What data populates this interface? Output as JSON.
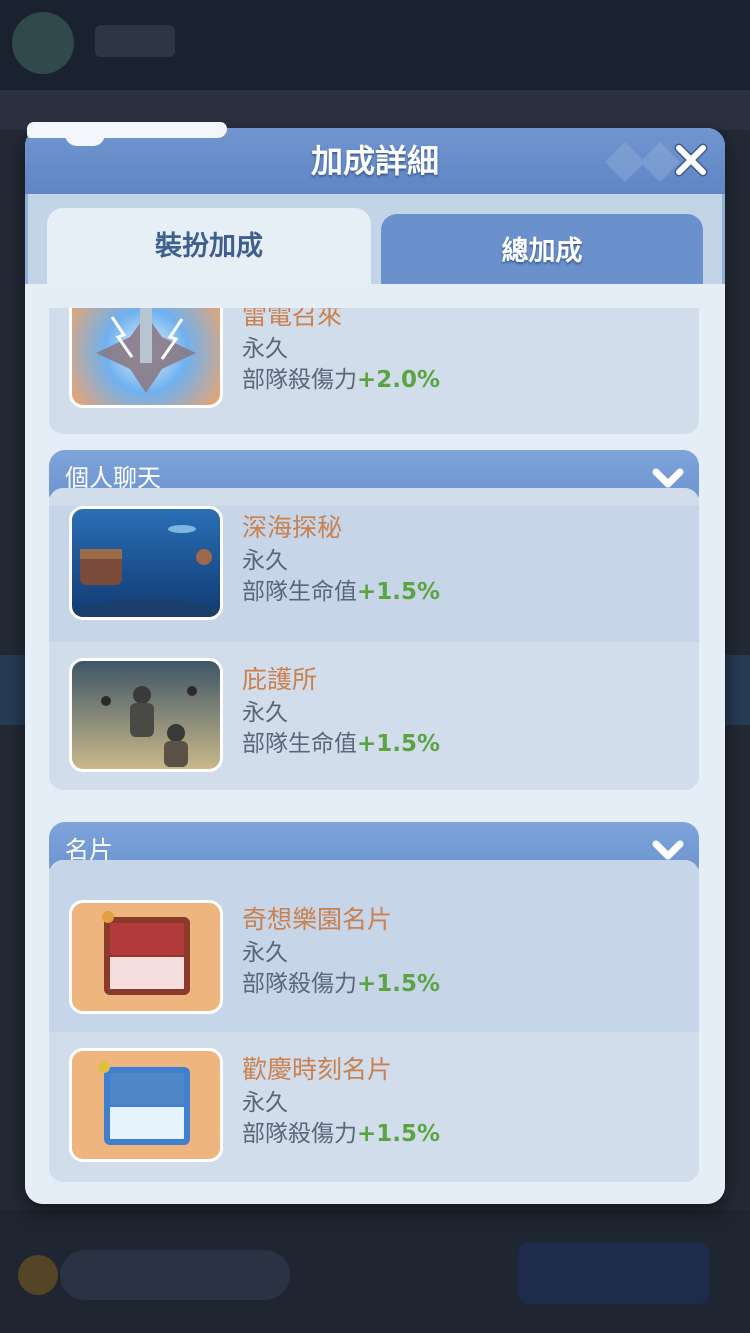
{
  "modal": {
    "title": "加成詳細",
    "tabs": [
      {
        "label": "裝扮加成",
        "active": true
      },
      {
        "label": "總加成",
        "active": false
      }
    ]
  },
  "partial_item": {
    "name": "雷電召來",
    "duration": "永久",
    "effect_label": "部隊殺傷力",
    "effect_value": "+2.0%"
  },
  "sections": [
    {
      "label": "個人聊天",
      "items": [
        {
          "name": "深海探秘",
          "duration": "永久",
          "effect_label": "部隊生命值",
          "effect_value": "+1.5%"
        },
        {
          "name": "庇護所",
          "duration": "永久",
          "effect_label": "部隊生命值",
          "effect_value": "+1.5%"
        }
      ]
    },
    {
      "label": "名片",
      "items": [
        {
          "name": "奇想樂園名片",
          "duration": "永久",
          "effect_label": "部隊殺傷力",
          "effect_value": "+1.5%"
        },
        {
          "name": "歡慶時刻名片",
          "duration": "永久",
          "effect_label": "部隊殺傷力",
          "effect_value": "+1.5%"
        }
      ]
    }
  ],
  "colors": {
    "header": "#6a92cf",
    "item_name": "#c9814f",
    "bonus_value": "#5aa542",
    "panel": "#e5edf6"
  }
}
